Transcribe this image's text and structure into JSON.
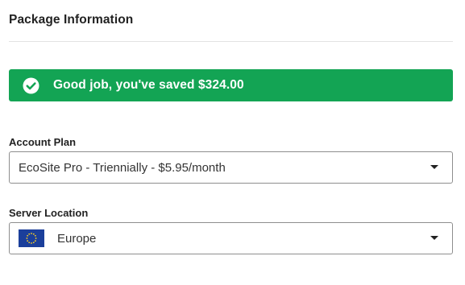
{
  "section": {
    "title": "Package Information"
  },
  "banner": {
    "message": "Good job, you've saved $324.00",
    "icon": "check-circle-icon",
    "color": "#13a454"
  },
  "account_plan": {
    "label": "Account Plan",
    "selected": "EcoSite Pro - Triennially - $5.95/month",
    "icon": "chevron-down-icon"
  },
  "server_location": {
    "label": "Server Location",
    "selected": "Europe",
    "flag_icon": "eu-flag-icon",
    "icon": "chevron-down-icon"
  }
}
